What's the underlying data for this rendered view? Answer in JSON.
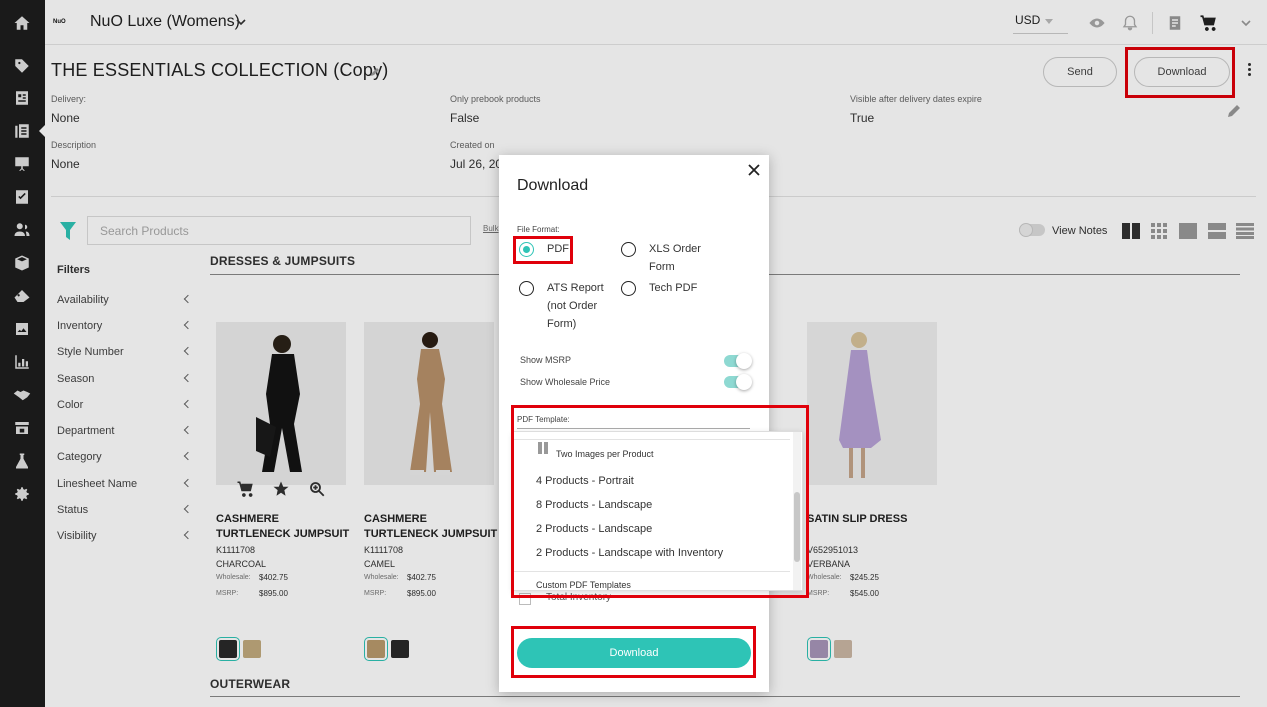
{
  "header": {
    "brand_logo_text": "NuO",
    "brand_name": "NuO Luxe (Womens)",
    "currency": "USD"
  },
  "page": {
    "title": "THE ESSENTIALS COLLECTION (Copy)",
    "send_label": "Send",
    "download_label": "Download",
    "meta": [
      {
        "label": "Delivery:",
        "value": "None"
      },
      {
        "label": "Only prebook products",
        "value": "False"
      },
      {
        "label": "Visible after delivery dates expire",
        "value": "True"
      },
      {
        "label": "Description",
        "value": "None"
      },
      {
        "label": "Created on",
        "value": "Jul 26, 20"
      }
    ]
  },
  "toolbar": {
    "search_placeholder": "Search Products",
    "bulk_label": "Bulk",
    "view_notes_label": "View Notes"
  },
  "filters": {
    "title": "Filters",
    "items": [
      "Availability",
      "Inventory",
      "Style Number",
      "Season",
      "Color",
      "Department",
      "Category",
      "Linesheet Name",
      "Status",
      "Visibility"
    ]
  },
  "sections": {
    "dresses": "DRESSES & JUMPSUITS",
    "outerwear": "OUTERWEAR"
  },
  "products": [
    {
      "name": "CASHMERE TURTLENECK JUMPSUIT",
      "sku": "K1111708",
      "color": "CHARCOAL",
      "wholesale_label": "Wholesale:",
      "wholesale": "$402.75",
      "msrp_label": "MSRP:",
      "msrp": "$895.00",
      "swatches": [
        "#2a2a2a",
        "#c2ab7e"
      ]
    },
    {
      "name": "CASHMERE TURTLENECK JUMPSUIT",
      "sku": "K1111708",
      "color": "CAMEL",
      "wholesale_label": "Wholesale:",
      "wholesale": "$402.75",
      "msrp_label": "MSRP:",
      "msrp": "$895.00",
      "swatches": [
        "#b99a6c",
        "#2a2a2a"
      ]
    },
    {
      "name": "SATIN SLIP DRESS",
      "sku": "V652951013",
      "color": "VERBANA",
      "wholesale_label": "Wholesale:",
      "wholesale": "$245.25",
      "msrp_label": "MSRP:",
      "msrp": "$545.00",
      "swatches": [
        "#a796b9",
        "#cbb7a4"
      ]
    }
  ],
  "modal": {
    "title": "Download",
    "file_format_label": "File Format:",
    "formats": [
      {
        "label": "PDF",
        "selected": true
      },
      {
        "label": "XLS Order Form",
        "selected": false
      },
      {
        "label": "ATS Report (not Order Form)",
        "selected": false
      },
      {
        "label": "Tech PDF",
        "selected": false
      }
    ],
    "show_msrp_label": "Show MSRP",
    "show_msrp": true,
    "show_wholesale_label": "Show Wholesale Price",
    "show_wholesale": true,
    "pdf_template_label": "PDF Template:",
    "template_options": [
      "Two Images per Product",
      "4 Products - Portrait",
      "8 Products - Landscape",
      "2 Products - Landscape",
      "2 Products - Landscape with Inventory"
    ],
    "custom_group_label": "Custom PDF Templates",
    "total_inventory_label": "Total Inventory",
    "download_label": "Download"
  },
  "colors": {
    "accent": "#2ec4b6",
    "highlight": "#e0000a",
    "rail": "#1d1d1d"
  }
}
